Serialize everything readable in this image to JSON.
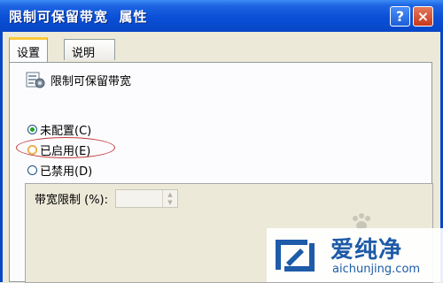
{
  "window": {
    "title": "限制可保留带宽  属性",
    "help_label": "?",
    "close_label": "×"
  },
  "tabs": [
    {
      "label": "设置",
      "active": true
    },
    {
      "label": "说明",
      "active": false
    }
  ],
  "policy": {
    "name": "限制可保留带宽",
    "icon": "policy-icon"
  },
  "radios": [
    {
      "label": "未配置(C)",
      "checked": true
    },
    {
      "label": "已启用(E)",
      "checked": false
    },
    {
      "label": "已禁用(D)",
      "checked": false
    }
  ],
  "options": {
    "bandwidth_label": "带宽限制 (%):",
    "bandwidth_value": ""
  },
  "watermark": {
    "brand": "爱纯净",
    "url": "aichunjing.com"
  },
  "colors": {
    "title_bar": "#0A4FD6",
    "dialog_bg": "#ECE9D8",
    "tab_accent": "#FFC83C",
    "highlight": "#C23A3A",
    "watermark": "#1E5BA8"
  }
}
